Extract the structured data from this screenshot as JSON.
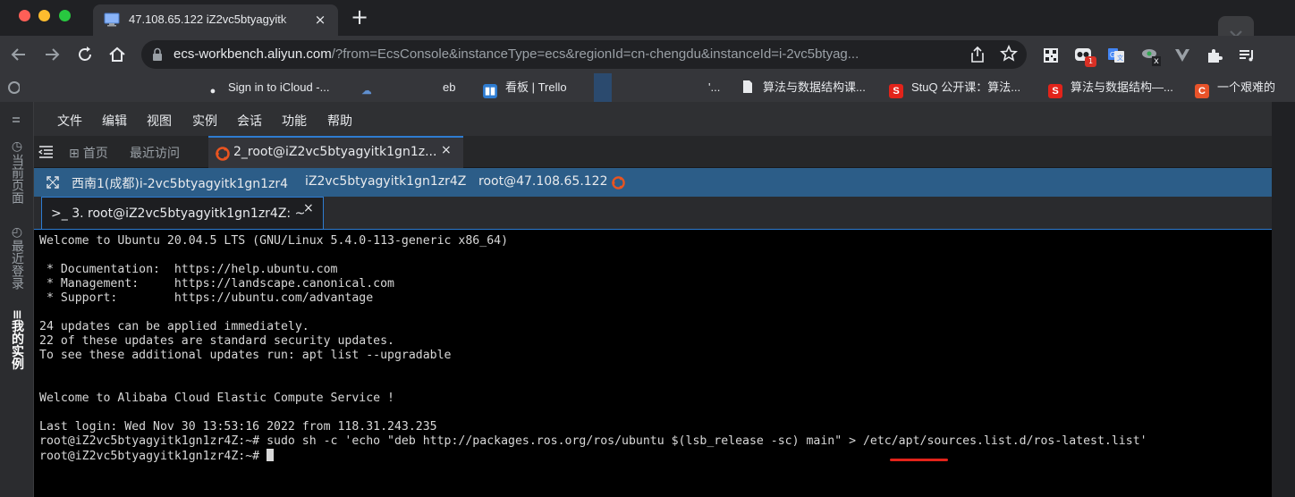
{
  "browser": {
    "tab": {
      "title": "47.108.65.122 iZ2vc5btyagyitk",
      "close": "×",
      "favicon": "remote-desktop-icon"
    },
    "new_tab": "+",
    "url_host": "ecs-workbench.aliyun.com",
    "url_rest": "/?from=EcsConsole&instanceType=ecs&regionId=cn-chengdu&instanceId=i-2vc5btyag...",
    "extension_badge": "1",
    "extension_x": "x"
  },
  "bookmarks": [
    {
      "label": "Sign in to iCloud -...",
      "icon": "apple-icon"
    },
    {
      "label": "eb",
      "icon": "cloud-icon"
    },
    {
      "label": "看板 | Trello",
      "icon": "trello-icon"
    },
    {
      "label": "'...",
      "icon": ""
    },
    {
      "label": "算法与数据结构课...",
      "icon": "page-icon"
    },
    {
      "label": "StuQ 公开课：算法...",
      "icon": "stuq-icon",
      "letter": "S"
    },
    {
      "label": "算法与数据结构—...",
      "icon": "stuq-icon",
      "letter": "S"
    },
    {
      "label": "一个艰难的",
      "icon": "c-icon",
      "letter": "C"
    }
  ],
  "rail": [
    {
      "label": "当前页面"
    },
    {
      "label": "最近登录"
    },
    {
      "label": "我的实例"
    }
  ],
  "menu": [
    "文件",
    "编辑",
    "视图",
    "实例",
    "会话",
    "功能",
    "帮助"
  ],
  "workbench_tabs": {
    "home": "首页",
    "recent": "最近访问",
    "active": "2_root@iZ2vc5btyagyitk1gn1z...",
    "close": "×"
  },
  "info": {
    "region": "西南1(成都)i-2vc5btyagyitk1gn1zr4",
    "host": "iZ2vc5btyagyitk1gn1zr4Z",
    "login": "root@47.108.65.122"
  },
  "terminal_tab": {
    "title": "3. root@iZ2vc5btyagyitk1gn1zr4Z: ~",
    "close": "×"
  },
  "terminal": {
    "lines": [
      "Welcome to Ubuntu 20.04.5 LTS (GNU/Linux 5.4.0-113-generic x86_64)",
      "",
      " * Documentation:  https://help.ubuntu.com",
      " * Management:     https://landscape.canonical.com",
      " * Support:        https://ubuntu.com/advantage",
      "",
      "24 updates can be applied immediately.",
      "22 of these updates are standard security updates.",
      "To see these additional updates run: apt list --upgradable",
      "",
      "",
      "Welcome to Alibaba Cloud Elastic Compute Service !",
      "",
      "Last login: Wed Nov 30 13:53:16 2022 from 118.31.243.235",
      "root@iZ2vc5btyagyitk1gn1zr4Z:~# sudo sh -c 'echo \"deb http://packages.ros.org/ros/ubuntu $(lsb_release -sc) main\" > /etc/apt/sources.list.d/ros-latest.list'"
    ],
    "prompt": "root@iZ2vc5btyagyitk1gn1zr4Z:~# "
  },
  "colors": {
    "accent": "#2e7cd1",
    "infobar": "#2c5d88",
    "annotation": "#e2231a"
  }
}
